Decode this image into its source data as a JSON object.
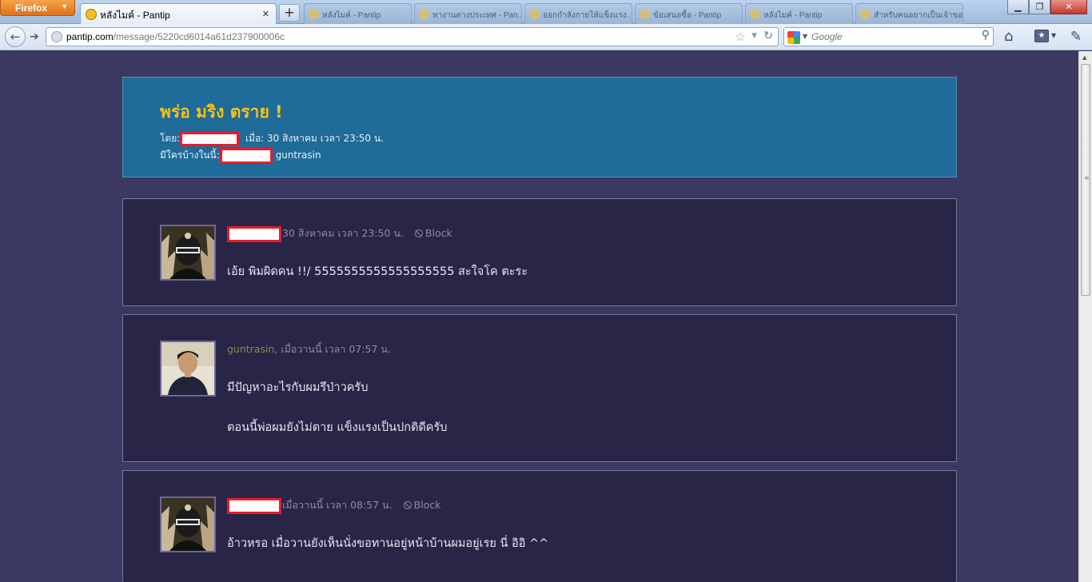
{
  "browser": {
    "app_button": "Firefox",
    "active_tab_title": "หลังไมค์ - Pantip",
    "background_tabs": [
      "หลังไมค์ - Pantip",
      "ทางานต่างประเทศ - Pan...",
      "ออกกำลังกายให้แข็งแรง...",
      "ข้อเสนอซื้อ - Pantip",
      "หลังไมค์ - Pantip",
      "สำหรับคนอยากเป็นเจ้าของ..."
    ],
    "new_tab_label": "+",
    "url_host": "pantip.com",
    "url_path": "/message/5220cd6014a61d237900006c",
    "search_placeholder": "Google",
    "window_minimize": "▁",
    "window_restore": "❐",
    "window_close": "✕"
  },
  "topic": {
    "title": "พร่อ มริง ตราย !",
    "by_label": "โดย:",
    "date_text": "เมื่อ: 30 สิงหาคม เวลา 23:50 น.",
    "participants_label": "มีใครบ้างในนี้:",
    "participant_name": "guntrasin"
  },
  "comments": [
    {
      "name": "",
      "time": "30 สิงหาคม เวลา 23:50 น.",
      "block_label": "Block",
      "lines": [
        "เอ้ย พิมผิดคน !!/ 5555555555555555555 สะใจโค ตะระ"
      ]
    },
    {
      "name": "guntrasin,",
      "time": "เมื่อวานนี้ เวลา 07:57 น.",
      "block_label": "",
      "lines": [
        "มีปัญหาอะไรกับผมรึป่าวครับ",
        "ตอนนี้พ่อผมยังไม่ตาย แข็งแรงเป็นปกติดีครับ"
      ]
    },
    {
      "name": "",
      "time": "เมื่อวานนี้ เวลา 08:57 น.",
      "block_label": "Block",
      "lines": [
        "อ้าวหรอ เมื่อวานยังเห็นนั่งขอทานอยู่หน้าบ้านผมอยู่เรย นี่ อิอิ ^^"
      ]
    }
  ]
}
